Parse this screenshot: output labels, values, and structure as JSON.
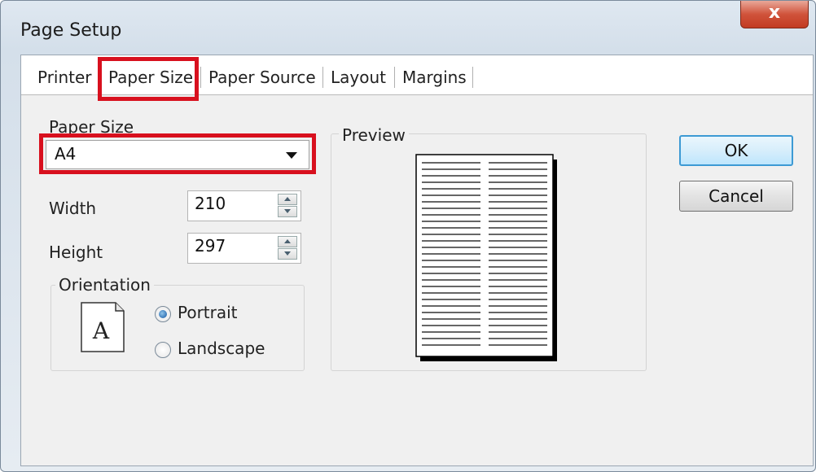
{
  "window": {
    "title": "Page Setup",
    "close_glyph": "x"
  },
  "tabs": [
    {
      "label": "Printer"
    },
    {
      "label": "Paper Size",
      "active": true,
      "highlighted": true
    },
    {
      "label": "Paper Source"
    },
    {
      "label": "Layout"
    },
    {
      "label": "Margins"
    }
  ],
  "paper_size": {
    "label": "Paper Size",
    "value": "A4",
    "highlighted": true
  },
  "width": {
    "label": "Width",
    "value": "210"
  },
  "height": {
    "label": "Height",
    "value": "297"
  },
  "orientation": {
    "label": "Orientation",
    "icon_letter": "A",
    "portrait_label": "Portrait",
    "landscape_label": "Landscape",
    "selected": "Portrait"
  },
  "preview": {
    "label": "Preview"
  },
  "buttons": {
    "ok": "OK",
    "cancel": "Cancel"
  },
  "colors": {
    "highlight": "#d8101e",
    "default_button_border": "#3d9ad4",
    "close_button": "#c23b22"
  }
}
